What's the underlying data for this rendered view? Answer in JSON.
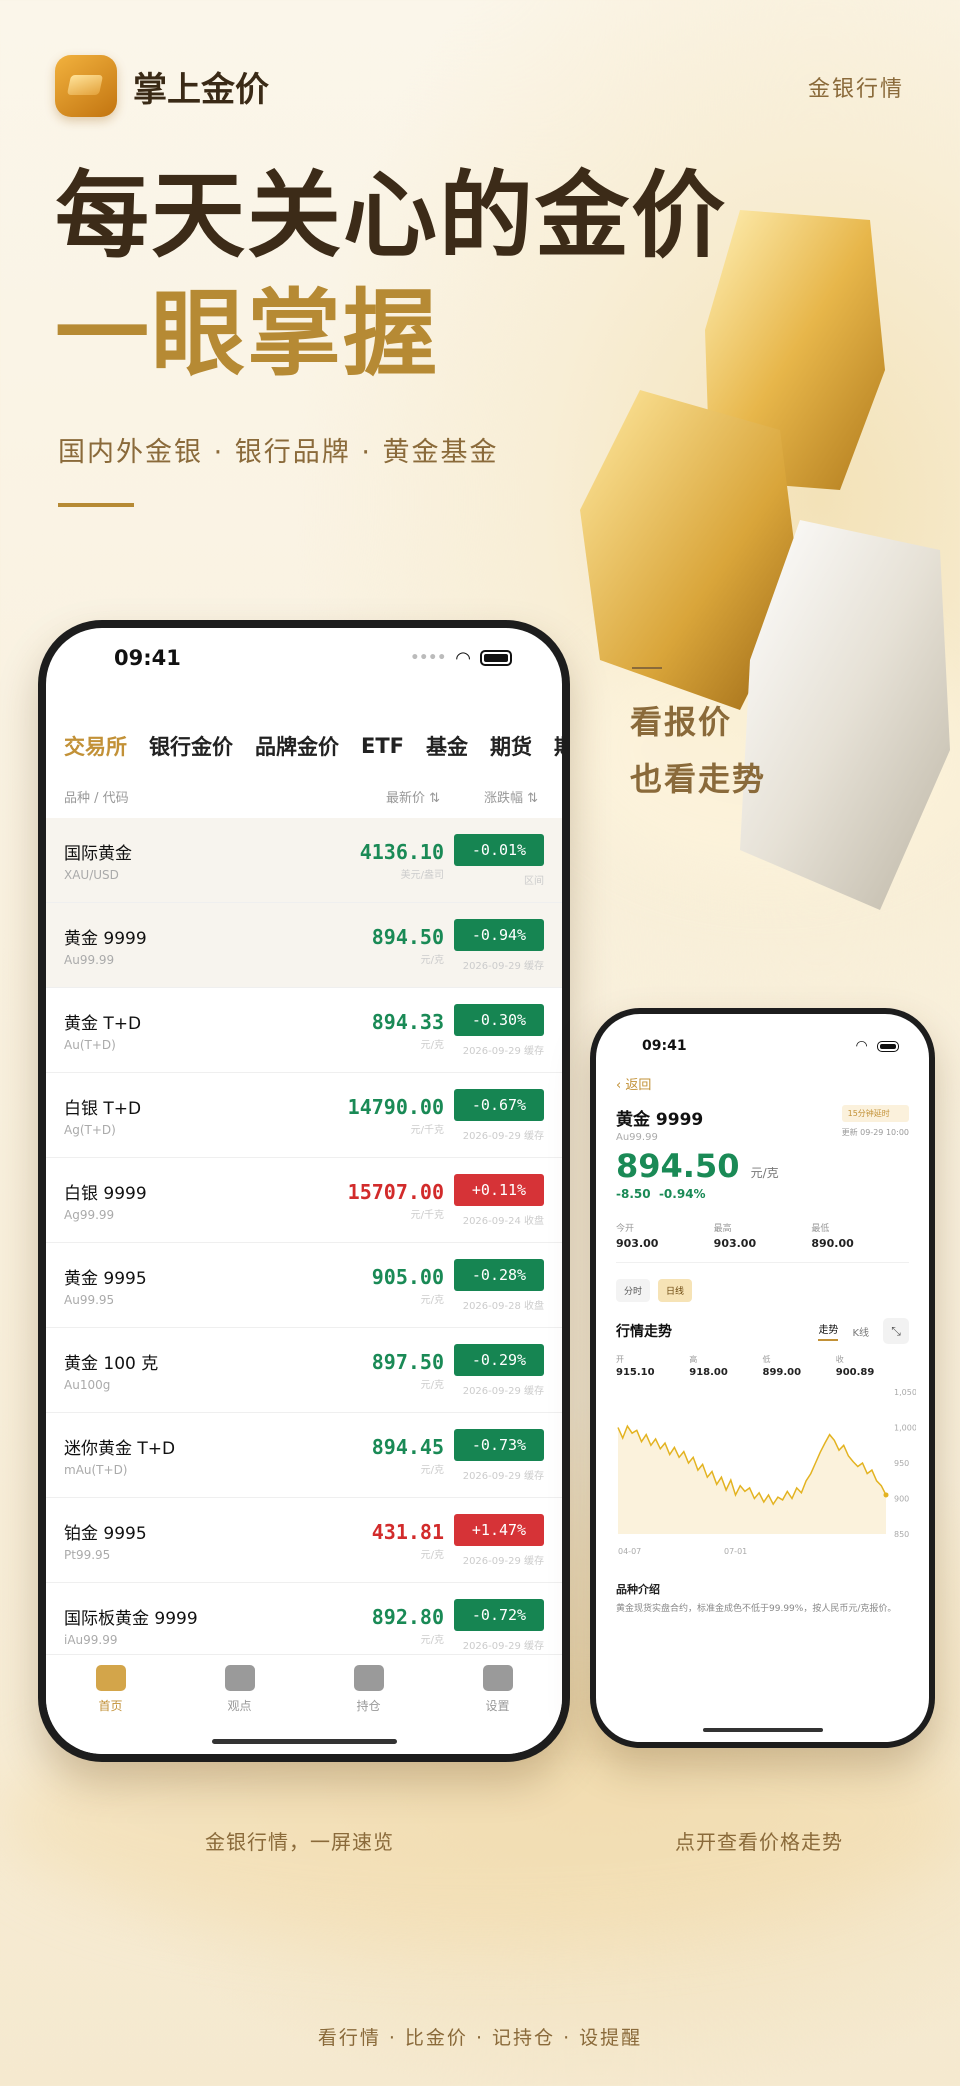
{
  "brand": {
    "app_name": "掌上金价",
    "top_right": "金银行情"
  },
  "hero": {
    "line1": "每天关心的金价",
    "line2": "一眼掌握",
    "subline": "国内外金银 · 银行品牌 · 黄金基金"
  },
  "side": {
    "line1": "看报价",
    "line2": "也看走势"
  },
  "captions": {
    "left": "金银行情，一屏速览",
    "right": "点开查看价格走势"
  },
  "footer": "看行情 · 比金价 · 记持仓 · 设提醒",
  "colors": {
    "accent": "#c29137",
    "up": "#d63337",
    "down": "#168552"
  },
  "list_phone": {
    "time": "09:41",
    "tabs": [
      "交易所",
      "银行金价",
      "品牌金价",
      "ETF",
      "基金",
      "期货",
      "期权"
    ],
    "active_tab": "交易所",
    "col_name": "品种 / 代码",
    "col_price": "最新价 ⇅",
    "col_change": "涨跌幅 ⇅",
    "rows": [
      {
        "name": "国际黄金",
        "code": "XAU/USD",
        "price": "4136.10",
        "unit": "美元/盎司",
        "change": "-0.01%",
        "note": "区间",
        "dir": "down"
      },
      {
        "name": "黄金 9999",
        "code": "Au99.99",
        "price": "894.50",
        "unit": "元/克",
        "change": "-0.94%",
        "note": "2026-09-29 缓存",
        "dir": "down"
      },
      {
        "name": "黄金 T+D",
        "code": "Au(T+D)",
        "price": "894.33",
        "unit": "元/克",
        "change": "-0.30%",
        "note": "2026-09-29 缓存",
        "dir": "down"
      },
      {
        "name": "白银 T+D",
        "code": "Ag(T+D)",
        "price": "14790.00",
        "unit": "元/千克",
        "change": "-0.67%",
        "note": "2026-09-29 缓存",
        "dir": "down"
      },
      {
        "name": "白银 9999",
        "code": "Ag99.99",
        "price": "15707.00",
        "unit": "元/千克",
        "change": "+0.11%",
        "note": "2026-09-24 收盘",
        "dir": "up"
      },
      {
        "name": "黄金 9995",
        "code": "Au99.95",
        "price": "905.00",
        "unit": "元/克",
        "change": "-0.28%",
        "note": "2026-09-28 收盘",
        "dir": "down"
      },
      {
        "name": "黄金 100 克",
        "code": "Au100g",
        "price": "897.50",
        "unit": "元/克",
        "change": "-0.29%",
        "note": "2026-09-29 缓存",
        "dir": "down"
      },
      {
        "name": "迷你黄金 T+D",
        "code": "mAu(T+D)",
        "price": "894.45",
        "unit": "元/克",
        "change": "-0.73%",
        "note": "2026-09-29 缓存",
        "dir": "down"
      },
      {
        "name": "铂金 9995",
        "code": "Pt99.95",
        "price": "431.81",
        "unit": "元/克",
        "change": "+1.47%",
        "note": "2026-09-29 缓存",
        "dir": "up"
      },
      {
        "name": "国际板黄金 9999",
        "code": "iAu99.99",
        "price": "892.80",
        "unit": "元/克",
        "change": "-0.72%",
        "note": "2026-09-29 缓存",
        "dir": "down"
      }
    ],
    "tabbar": [
      {
        "label": "首页",
        "icon": "home-icon"
      },
      {
        "label": "观点",
        "icon": "quote-icon"
      },
      {
        "label": "持仓",
        "icon": "tray-icon"
      },
      {
        "label": "设置",
        "icon": "gear-icon"
      }
    ]
  },
  "detail_phone": {
    "time": "09:41",
    "back": "返回",
    "name": "黄金 9999",
    "code": "Au99.99",
    "badge": "15分钟延时",
    "updated": "更新 09-29 10:00",
    "price": "894.50",
    "unit": "元/克",
    "change_abs": "-8.50",
    "change_pct": "-0.94%",
    "stats": [
      {
        "k": "今开",
        "v": "903.00"
      },
      {
        "k": "最高",
        "v": "903.00"
      },
      {
        "k": "最低",
        "v": "890.00"
      }
    ],
    "modes": [
      "分时",
      "日线"
    ],
    "active_mode": "日线",
    "trend_title": "行情走势",
    "trend_tabs": [
      "走势",
      "K线"
    ],
    "ohlc": [
      {
        "k": "开",
        "v": "915.10"
      },
      {
        "k": "高",
        "v": "918.00"
      },
      {
        "k": "低",
        "v": "899.00"
      },
      {
        "k": "收",
        "v": "900.89"
      }
    ],
    "intro_title": "品种介绍",
    "intro_text": "黄金现货实盘合约，标准金成色不低于99.99%，按人民币元/克报价。"
  },
  "chart_data": {
    "type": "area",
    "x_labels": [
      "04-07",
      "07-01"
    ],
    "y_ticks": [
      1050,
      1000,
      950,
      900,
      850
    ],
    "ylim": [
      850,
      1050
    ],
    "values": [
      1000,
      985,
      1002,
      992,
      996,
      980,
      990,
      975,
      984,
      970,
      978,
      962,
      972,
      958,
      966,
      950,
      958,
      940,
      948,
      930,
      938,
      920,
      930,
      912,
      926,
      905,
      918,
      910,
      915,
      900,
      908,
      895,
      905,
      892,
      902,
      898,
      910,
      900,
      915,
      908,
      925,
      935,
      950,
      965,
      978,
      990,
      982,
      968,
      975,
      960,
      952,
      945,
      950,
      935,
      940,
      925,
      918,
      905
    ]
  }
}
